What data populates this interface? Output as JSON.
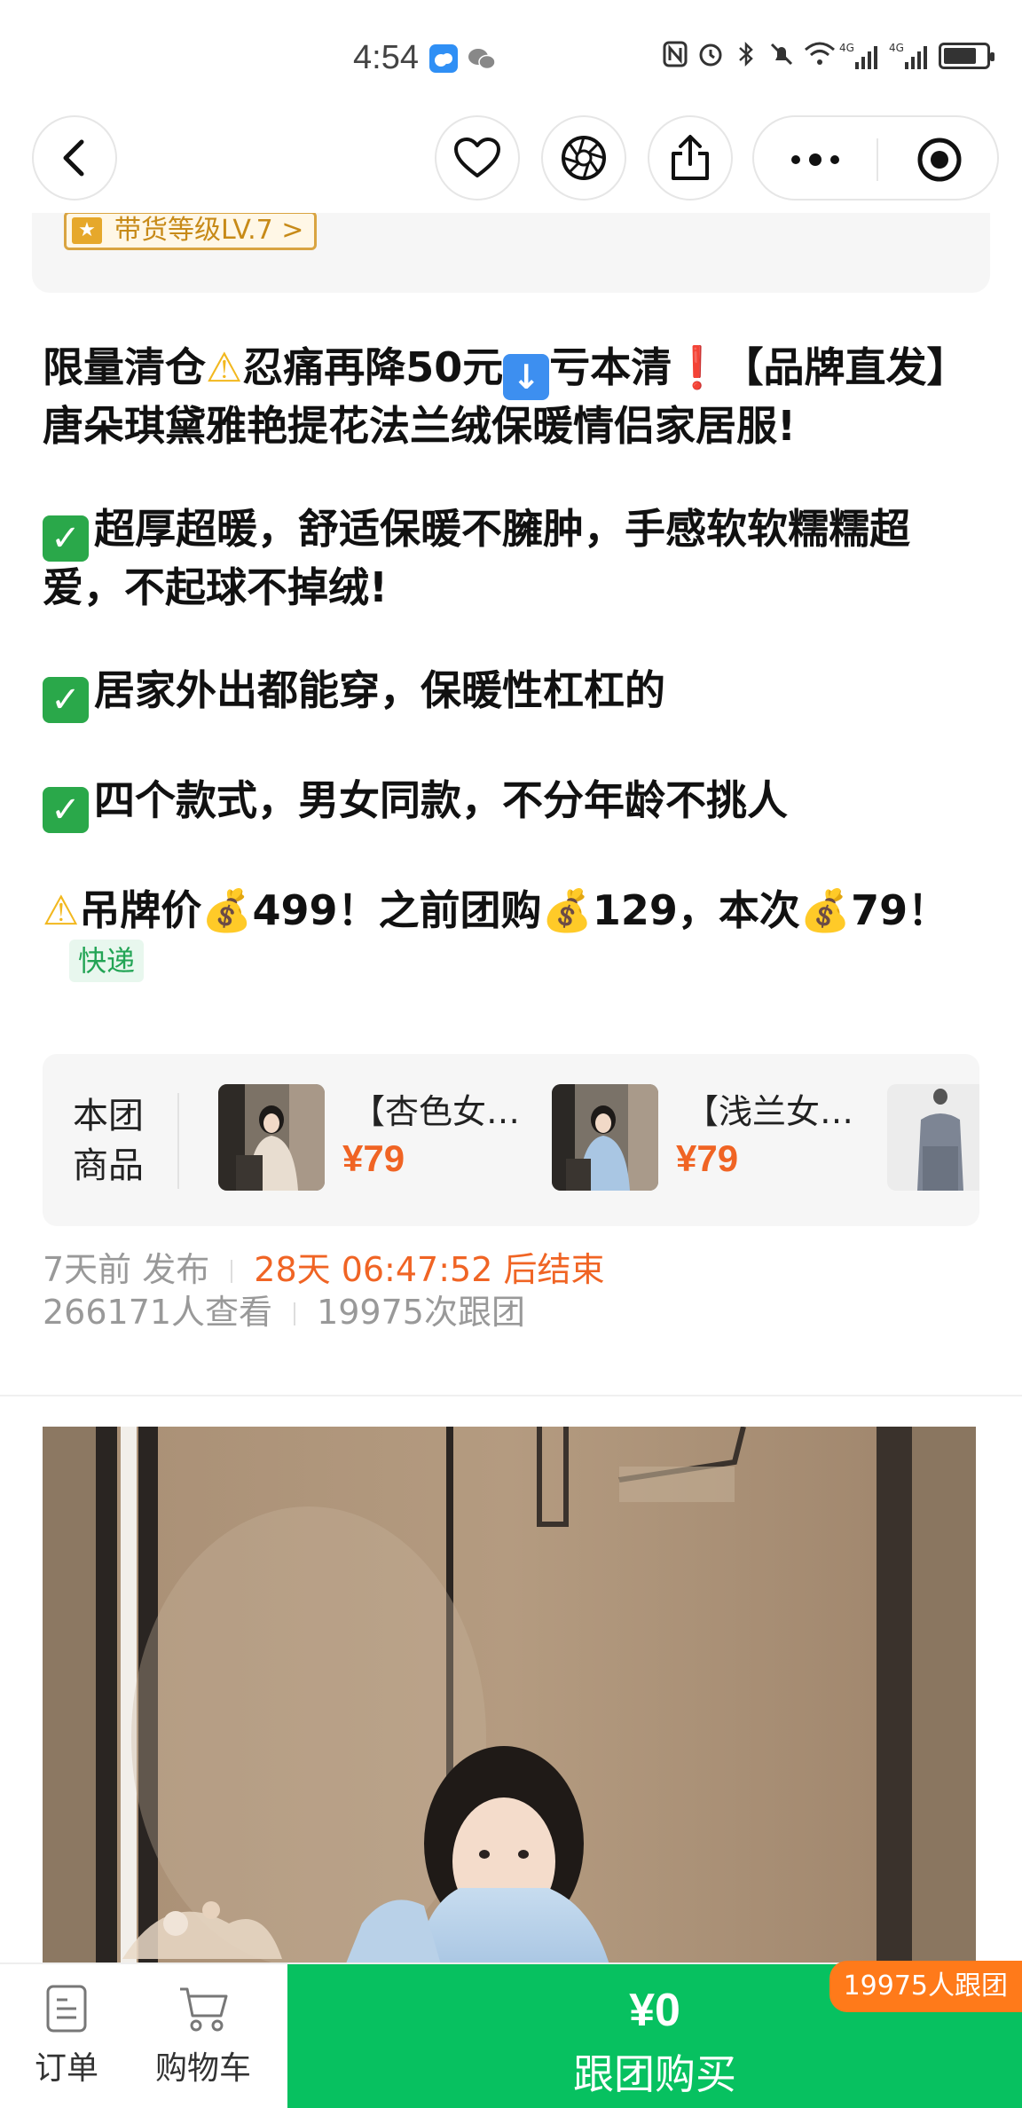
{
  "status_bar": {
    "time": "4:54",
    "app_icons": [
      "weather-app-icon",
      "wechat-icon"
    ],
    "right_icons": [
      "nfc-icon",
      "alarm-icon",
      "bluetooth-icon",
      "mute-icon",
      "wifi-icon",
      "signal-4g-icon",
      "signal-4g-icon",
      "battery-charging-icon"
    ],
    "signal_label_1": "4G",
    "signal_label_2": "4G"
  },
  "navbar": {
    "back_icon": "back-icon",
    "favorite_icon": "heart-icon",
    "camera_icon": "shutter-icon",
    "share_icon": "share-icon",
    "more_icon": "more-dots-icon",
    "close_icon": "target-icon"
  },
  "seller": {
    "level_badge": "带货等级LV.7 >"
  },
  "post": {
    "line1_a": "限量清仓",
    "line1_b": "忍痛再降50元",
    "line1_c": "亏本清",
    "line1_d": "【品牌直发】唐朵琪黛雅艳提花法兰绒保暖情侣家居服!",
    "line2": "超厚超暖，舒适保暖不臃肿，手感软软糯糯超爱，不起球不掉绒!",
    "line3": "居家外出都能穿，保暖性杠杠的",
    "line4": "四个款式，男女同款，不分年龄不挑人",
    "line5_a": "吊牌价",
    "line5_b": "499！之前团购",
    "line5_c": "129，本次",
    "line5_d": "79！",
    "express_tag": "快递"
  },
  "products": {
    "label": "本团商品",
    "items": [
      {
        "name": "【杏色女…",
        "price": "¥79"
      },
      {
        "name": "【浅兰女…",
        "price": "¥79"
      }
    ]
  },
  "meta": {
    "published": "7天前 发布",
    "countdown": "28天 06:47:52 后结束",
    "views": "266171人查看",
    "joins": "19975次跟团"
  },
  "bottom_bar": {
    "orders_label": "订单",
    "cart_label": "购物车",
    "buy_price": "¥0",
    "buy_label": "跟团购买",
    "follow_badge": "19975人跟团"
  },
  "colors": {
    "brand_green": "#07c160",
    "accent_orange": "#f06424",
    "badge_orange": "#ff7a1a"
  }
}
